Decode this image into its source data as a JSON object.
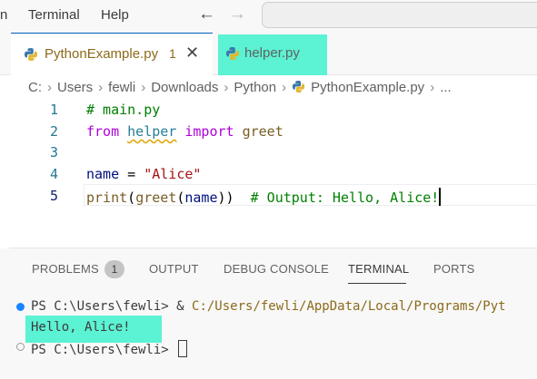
{
  "menubar": {
    "items": [
      "n",
      "Terminal",
      "Help"
    ],
    "back_arrow": "←",
    "forward_arrow": "→"
  },
  "tabs": [
    {
      "label": "PythonExample.py",
      "modified_count": "1",
      "close": "✕",
      "icon": "python-icon"
    },
    {
      "label": "helper.py",
      "icon": "python-icon"
    }
  ],
  "breadcrumb": {
    "segments": [
      "C:",
      "Users",
      "fewli",
      "Downloads",
      "Python",
      "PythonExample.py",
      "..."
    ],
    "separator": "›"
  },
  "editor": {
    "line_numbers": [
      "1",
      "2",
      "3",
      "4",
      "5"
    ],
    "lines": {
      "l1": {
        "comment": "# main.py"
      },
      "l2": {
        "kw_from": "from",
        "module": "helper",
        "kw_import": "import",
        "name": "greet"
      },
      "l4": {
        "var": "name",
        "op": " = ",
        "str": "\"Alice\""
      },
      "l5": {
        "fn_print": "print",
        "p1": "(",
        "fn_greet": "greet",
        "p2": "(",
        "arg": "name",
        "p3": "))",
        "comment": "# Output: Hello, Alice!"
      }
    }
  },
  "panel": {
    "tabs": [
      "PROBLEMS",
      "OUTPUT",
      "DEBUG CONSOLE",
      "TERMINAL",
      "PORTS"
    ],
    "problems_badge": "1",
    "active_tab": "TERMINAL"
  },
  "terminal": {
    "line1_prompt": "PS C:\\Users\\fewli> ",
    "line1_amp": "& ",
    "line1_path": "C:/Users/fewli/AppData/Local/Programs/Pyt",
    "line2": "Hello, Alice!",
    "line3_prompt": "PS C:\\Users\\fewli> "
  },
  "colors": {
    "highlight": "#5cf2d4",
    "accent": "#005fb8",
    "modified_text": "#8c6a1a"
  }
}
